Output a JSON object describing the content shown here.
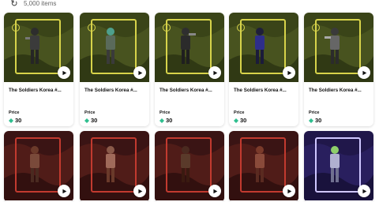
{
  "header": {
    "refresh_icon": "refresh-icon",
    "items_count": "5,000 items"
  },
  "cards_row1": [
    {
      "name": "The Soldiers Korea #...",
      "price_label": "Price",
      "price": "30",
      "theme": "green"
    },
    {
      "name": "The Soldiers Korea #...",
      "price_label": "Price",
      "price": "30",
      "theme": "green"
    },
    {
      "name": "The Soldiers Korea #...",
      "price_label": "Price",
      "price": "30",
      "theme": "green"
    },
    {
      "name": "The Soldiers Korea #...",
      "price_label": "Price",
      "price": "30",
      "theme": "green"
    },
    {
      "name": "The Soldiers Korea #...",
      "price_label": "Price",
      "price": "30",
      "theme": "green"
    }
  ],
  "cards_row2": [
    {
      "theme": "red"
    },
    {
      "theme": "red"
    },
    {
      "theme": "red"
    },
    {
      "theme": "red"
    },
    {
      "theme": "purple"
    }
  ],
  "colors": {
    "green_bg": "#3a4418",
    "green_frame": "#d7d34a",
    "red_bg": "#3a1414",
    "red_frame": "#c23a2f",
    "purple_bg": "#20174a",
    "purple_frame": "#cfc7ff",
    "price_diamond": "#2fbf8f"
  }
}
